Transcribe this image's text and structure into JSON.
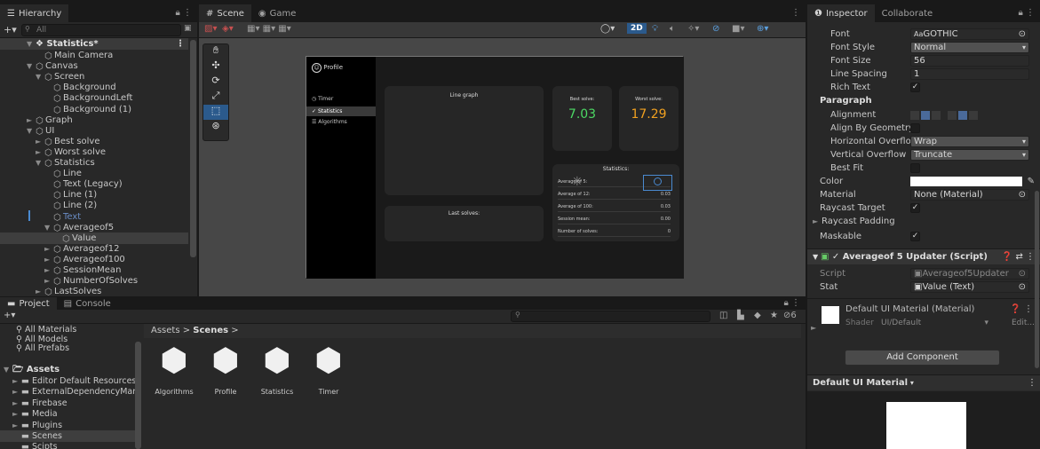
{
  "hierarchy": {
    "tab": "Hierarchy",
    "search_placeholder": "All",
    "scene_name": "Statistics*",
    "items": [
      {
        "label": "Main Camera",
        "depth": 2,
        "arrow": ""
      },
      {
        "label": "Canvas",
        "depth": 1,
        "arrow": "▼"
      },
      {
        "label": "Screen",
        "depth": 2,
        "arrow": "▼"
      },
      {
        "label": "Background",
        "depth": 3,
        "arrow": ""
      },
      {
        "label": "BackgroundLeft",
        "depth": 3,
        "arrow": ""
      },
      {
        "label": "Background (1)",
        "depth": 3,
        "arrow": ""
      },
      {
        "label": "Graph",
        "depth": 1,
        "arrow": "►"
      },
      {
        "label": "UI",
        "depth": 1,
        "arrow": "▼"
      },
      {
        "label": "Best solve",
        "depth": 2,
        "arrow": "►"
      },
      {
        "label": "Worst solve",
        "depth": 2,
        "arrow": "►"
      },
      {
        "label": "Statistics",
        "depth": 2,
        "arrow": "▼"
      },
      {
        "label": "Line",
        "depth": 3,
        "arrow": ""
      },
      {
        "label": "Text (Legacy)",
        "depth": 3,
        "arrow": ""
      },
      {
        "label": "Line (1)",
        "depth": 3,
        "arrow": ""
      },
      {
        "label": "Line (2)",
        "depth": 3,
        "arrow": ""
      },
      {
        "label": "Text",
        "depth": 3,
        "arrow": "",
        "disabled": true
      },
      {
        "label": "Averageof5",
        "depth": 3,
        "arrow": "▼"
      },
      {
        "label": "Value",
        "depth": 4,
        "arrow": "",
        "selected": true
      },
      {
        "label": "Averageof12",
        "depth": 3,
        "arrow": "►"
      },
      {
        "label": "Averageof100",
        "depth": 3,
        "arrow": "►"
      },
      {
        "label": "SessionMean",
        "depth": 3,
        "arrow": "►"
      },
      {
        "label": "NumberOfSolves",
        "depth": 3,
        "arrow": "►"
      },
      {
        "label": "LastSolves",
        "depth": 2,
        "arrow": "►"
      }
    ]
  },
  "scene": {
    "tab_scene": "Scene",
    "tab_game": "Game",
    "btn_2d": "2D",
    "app": {
      "profile": "Profile",
      "menu": [
        "Timer",
        "Statistics",
        "Algorithms"
      ],
      "line_graph": "Line graph",
      "best_label": "Best solve:",
      "best_value": "7.03",
      "worst_label": "Worst solve:",
      "worst_value": "17.29",
      "stats_title": "Statistics:",
      "stats_rows": [
        {
          "label": "Average of 5:",
          "value": ""
        },
        {
          "label": "Average of 12:",
          "value": "0.03"
        },
        {
          "label": "Average of 100:",
          "value": "0.03"
        },
        {
          "label": "Session mean:",
          "value": "0.00"
        },
        {
          "label": "Number of solves:",
          "value": "0"
        }
      ],
      "last_solves": "Last solves:"
    }
  },
  "project": {
    "tab_project": "Project",
    "tab_console": "Console",
    "count": "6",
    "favorites": [
      "All Materials",
      "All Models",
      "All Prefabs"
    ],
    "assets_root": "Assets",
    "folders": [
      "Editor Default Resources",
      "ExternalDependencyMan",
      "Firebase",
      "Media",
      "Plugins",
      "Scenes",
      "Scipts"
    ],
    "breadcrumb_root": "Assets",
    "breadcrumb_current": "Scenes",
    "scenes": [
      "Algorithms",
      "Profile",
      "Statistics",
      "Timer"
    ]
  },
  "inspector": {
    "tab_inspector": "Inspector",
    "tab_collaborate": "Collaborate",
    "font_label": "Font",
    "font_value": "GOTHIC",
    "font_style_label": "Font Style",
    "font_style_value": "Normal",
    "font_size_label": "Font Size",
    "font_size_value": "56",
    "line_spacing_label": "Line Spacing",
    "line_spacing_value": "1",
    "rich_text_label": "Rich Text",
    "paragraph_label": "Paragraph",
    "alignment_label": "Alignment",
    "align_geom_label": "Align By Geometry",
    "h_overflow_label": "Horizontal Overflo",
    "h_overflow_value": "Wrap",
    "v_overflow_label": "Vertical Overflow",
    "v_overflow_value": "Truncate",
    "best_fit_label": "Best Fit",
    "color_label": "Color",
    "material_label": "Material",
    "material_value": "None (Material)",
    "raycast_target_label": "Raycast Target",
    "raycast_padding_label": "Raycast Padding",
    "maskable_label": "Maskable",
    "component_title": "Averageof 5 Updater (Script)",
    "script_label": "Script",
    "script_value": "Averageof5Updater",
    "stat_label": "Stat",
    "stat_value": "Value (Text)",
    "material_title": "Default UI Material (Material)",
    "shader_label": "Shader",
    "shader_value": "UI/Default",
    "edit_label": "Edit...",
    "add_component": "Add Component",
    "preview_title": "Default UI Material"
  }
}
